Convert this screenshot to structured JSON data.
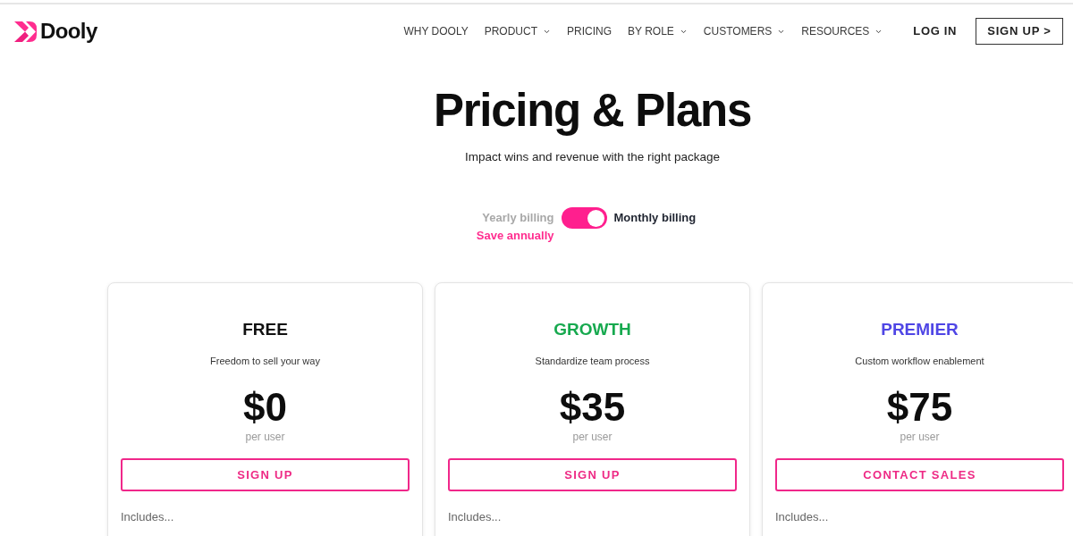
{
  "header": {
    "brand": "Dooly",
    "nav": [
      {
        "label": "WHY DOOLY",
        "dropdown": false
      },
      {
        "label": "PRODUCT",
        "dropdown": true
      },
      {
        "label": "PRICING",
        "dropdown": false
      },
      {
        "label": "BY ROLE",
        "dropdown": true
      },
      {
        "label": "CUSTOMERS",
        "dropdown": true
      },
      {
        "label": "RESOURCES",
        "dropdown": true
      }
    ],
    "login": "LOG IN",
    "signup": "SIGN UP >"
  },
  "hero": {
    "title": "Pricing & Plans",
    "subtitle": "Impact wins and revenue with the right package"
  },
  "billing": {
    "options": [
      {
        "label": "Yearly billing",
        "selected": false
      },
      {
        "label": "Monthly billing",
        "selected": true
      }
    ],
    "note": "Save annually"
  },
  "plans": [
    {
      "name": "FREE",
      "color": "#111111",
      "description": "Freedom to sell your way",
      "price": "$0",
      "unit": "per user",
      "button": "SIGN UP",
      "includes": "Includes..."
    },
    {
      "name": "GROWTH",
      "color": "#17a94f",
      "description": "Standardize team process",
      "price": "$35",
      "unit": "per user",
      "button": "SIGN UP",
      "includes": "Includes..."
    },
    {
      "name": "PREMIER",
      "color": "#4f46e5",
      "description": "Custom workflow enablement",
      "price": "$75",
      "unit": "per user",
      "button": "CONTACT SALES",
      "includes": "Includes..."
    }
  ]
}
